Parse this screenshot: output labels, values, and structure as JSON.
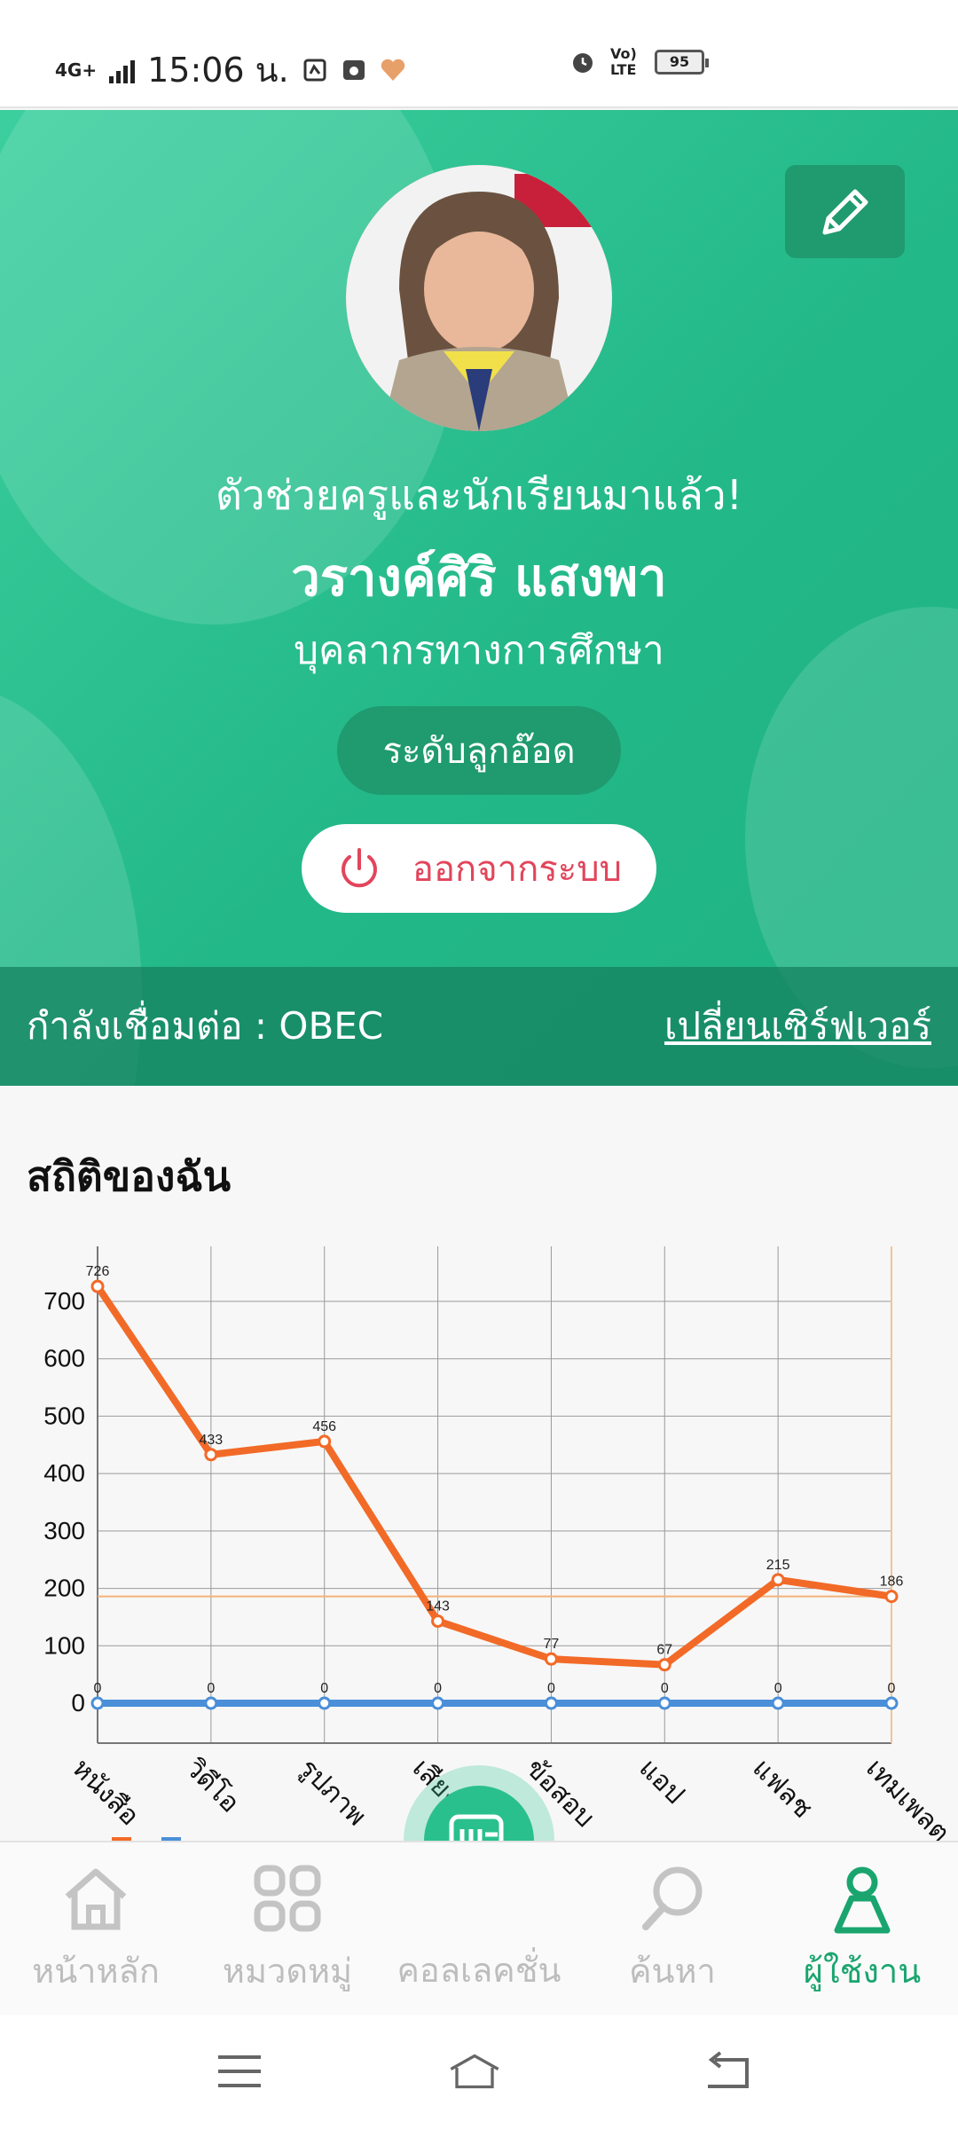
{
  "status_bar": {
    "network": "4G+",
    "time": "15:06 น.",
    "volte": "Vo) LTE",
    "battery": "95"
  },
  "profile": {
    "tagline": "ตัวช่วยครูและนักเรียนมาแล้ว!",
    "name": "วรางค์ศิริ แสงพา",
    "role": "บุคลากรทางการศึกษา",
    "level": "ระดับลูกอ๊อด",
    "logout": "ออกจากระบบ"
  },
  "connection": {
    "label": "กำลังเชื่อมต่อ : OBEC",
    "switch": "เปลี่ยนเซิร์ฟเวอร์"
  },
  "stats": {
    "title": "สถิติของฉัน"
  },
  "chart_data": {
    "type": "line",
    "categories": [
      "หนังสือ",
      "วิดีโอ",
      "รูปภาพ",
      "เสียง",
      "ข้อสอบ",
      "แอป",
      "แฟลช",
      "เทมเพลต"
    ],
    "series": [
      {
        "values": [
          726,
          433,
          456,
          143,
          77,
          67,
          215,
          186
        ],
        "color": "#f26a27"
      },
      {
        "values": [
          0,
          0,
          0,
          0,
          0,
          0,
          0,
          0
        ],
        "color": "#4a8fd8"
      }
    ],
    "y_ticks": [
      "0",
      "100",
      "200",
      "300",
      "400",
      "500",
      "600",
      "700"
    ],
    "ylim": [
      0,
      800
    ],
    "limit_line": 186,
    "grid": true,
    "legend": "bottom-left"
  },
  "bottom_nav": {
    "items": [
      {
        "label": "หน้าหลัก",
        "icon": "home-icon"
      },
      {
        "label": "หมวดหมู่",
        "icon": "category-icon"
      },
      {
        "label": "คอลเลคชั่น",
        "icon": "collection-icon"
      },
      {
        "label": "ค้นหา",
        "icon": "search-icon"
      },
      {
        "label": "ผู้ใช้งาน",
        "icon": "user-icon"
      }
    ]
  },
  "colors": {
    "accent": "#23b888",
    "logout": "#e2455c",
    "series_orange": "#f26a27",
    "series_blue": "#4a8fd8"
  }
}
